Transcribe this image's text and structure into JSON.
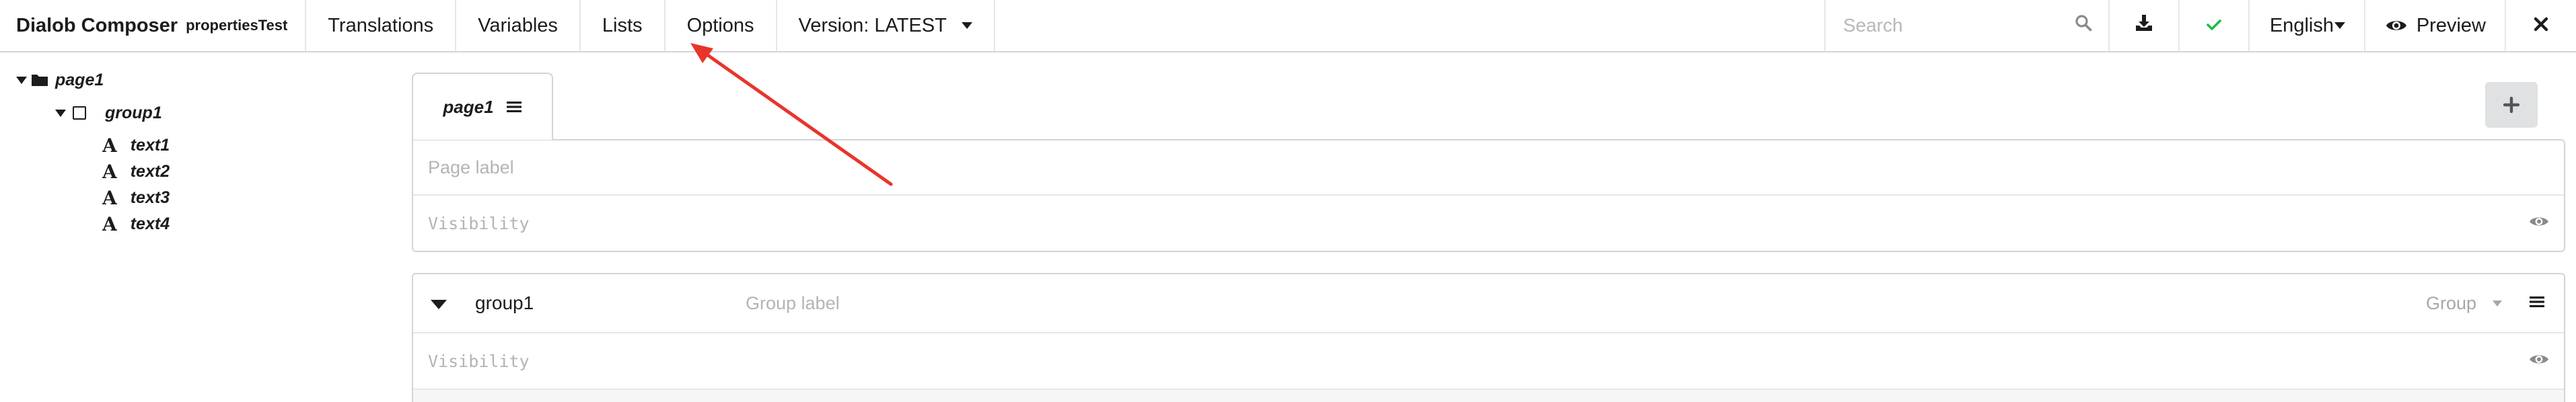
{
  "app": {
    "title": "Dialob Composer",
    "form_name": "propertiesTest"
  },
  "menu": {
    "translations": "Translations",
    "variables": "Variables",
    "lists": "Lists",
    "options": "Options",
    "version": "Version: LATEST"
  },
  "toolbar": {
    "search_placeholder": "Search",
    "language": "English",
    "preview": "Preview",
    "icons": {
      "search": "search-icon",
      "download": "download-icon",
      "status": "check-icon",
      "preview": "eye-icon",
      "close": "close-icon"
    }
  },
  "tree": {
    "page": "page1",
    "group": "group1",
    "items": [
      "text1",
      "text2",
      "text3",
      "text4"
    ],
    "text_glyph": "A"
  },
  "page": {
    "tab_label": "page1",
    "label_placeholder": "Page label",
    "visibility_placeholder": "Visibility"
  },
  "group": {
    "id": "group1",
    "label_placeholder": "Group label",
    "type": "Group",
    "visibility_placeholder": "Visibility"
  },
  "colors": {
    "accent_check": "#21ba45",
    "annotation_arrow": "#e8352a",
    "border": "#d4d4d5",
    "add_button_bg": "#e0e1e2"
  }
}
